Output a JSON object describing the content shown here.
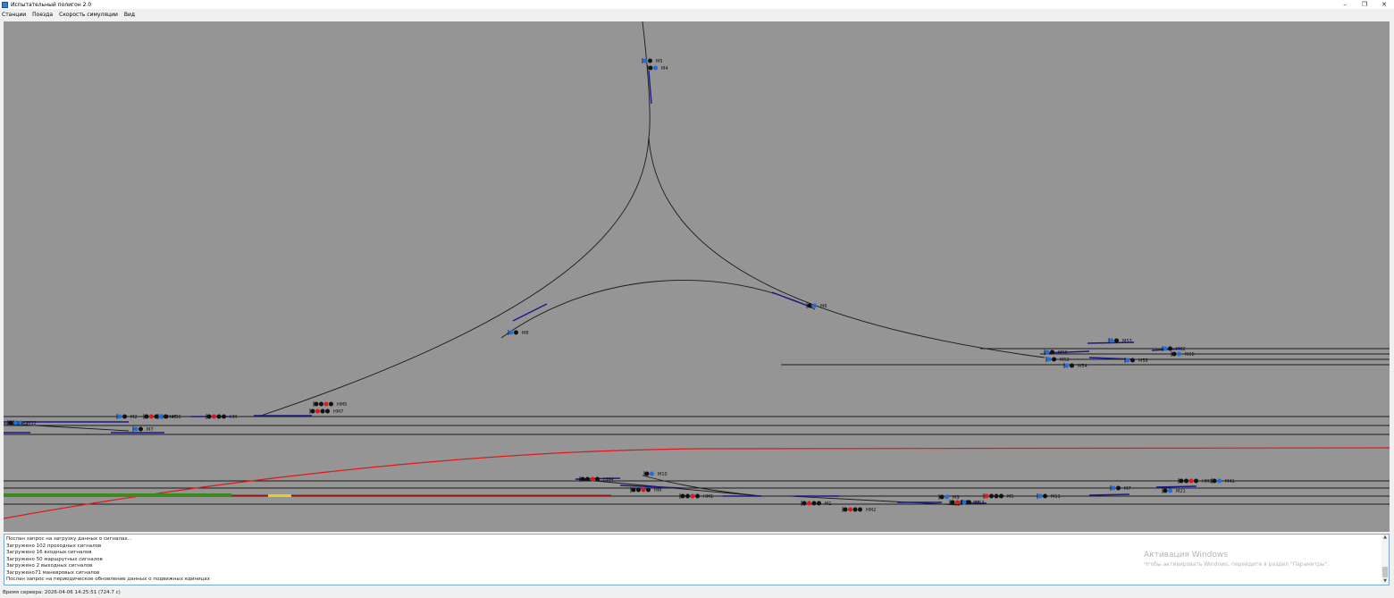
{
  "window": {
    "title": "Испытательный полигон 2.0",
    "minimize": "–",
    "restore": "❐",
    "close": "✕"
  },
  "menu": {
    "items": [
      "Станции",
      "Поезда",
      "Скорость симуляции",
      "Вид"
    ]
  },
  "colors": {
    "canvas_bg": "#959595",
    "track": "#1a1a1a",
    "route": "#1a1a8c",
    "occupied": "#e01818",
    "train": "#3c8a1e",
    "signal_blue": "#1e6ee0",
    "signal_red": "#e01818",
    "signal_black": "#111111",
    "highlight": "#e4d21a"
  },
  "canvas": {
    "signals": [
      {
        "label": "M8",
        "lights": [
          "blue",
          "black"
        ]
      },
      {
        "label": "M6",
        "lights": [
          "black",
          "blue"
        ]
      },
      {
        "label": "M5",
        "lights": [
          "blue",
          "black"
        ]
      },
      {
        "label": "M4",
        "lights": [
          "black",
          "blue"
        ]
      },
      {
        "label": "M2",
        "lights": [
          "blue",
          "black"
        ]
      },
      {
        "label": "M32",
        "lights": [
          "black",
          "blue"
        ]
      },
      {
        "label": "M56",
        "lights": [
          "blue",
          "black"
        ]
      },
      {
        "label": "M52",
        "lights": [
          "blue",
          "black"
        ]
      },
      {
        "label": "M54",
        "lights": [
          "blue",
          "black"
        ]
      },
      {
        "label": "M53",
        "lights": [
          "blue",
          "black"
        ]
      },
      {
        "label": "M58",
        "lights": [
          "blue",
          "black"
        ]
      },
      {
        "label": "M62",
        "lights": [
          "blue",
          "black"
        ]
      },
      {
        "label": "M60",
        "lights": [
          "black",
          "blue"
        ]
      },
      {
        "label": "M10",
        "lights": [
          "black",
          "blue"
        ]
      },
      {
        "label": "M7",
        "lights": [
          "blue",
          "black"
        ]
      },
      {
        "label": "НМ1",
        "lights": [
          "black",
          "black",
          "red",
          "black"
        ]
      },
      {
        "label": "НМ",
        "lights": [
          "black",
          "black",
          "red",
          "black"
        ]
      },
      {
        "label": "M1",
        "lights": [
          "black",
          "red",
          "black",
          "black"
        ]
      },
      {
        "label": "НМ2",
        "lights": [
          "black",
          "red",
          "black",
          "black"
        ]
      },
      {
        "label": "НМ4",
        "lights": [
          "black",
          "black",
          "red",
          "black"
        ]
      },
      {
        "label": "M3",
        "lights": [
          "black",
          "red",
          "black",
          "black"
        ]
      },
      {
        "label": "M5",
        "lights": [
          "red",
          "black",
          "black",
          "black"
        ]
      },
      {
        "label": "M13",
        "lights": [
          "blue",
          "black"
        ]
      },
      {
        "label": "M9",
        "lights": [
          "black",
          "blue"
        ]
      },
      {
        "label": "M11",
        "lights": [
          "blue",
          "black"
        ]
      },
      {
        "label": "M21",
        "lights": [
          "black",
          "blue"
        ]
      },
      {
        "label": "НМ3",
        "lights": [
          "black",
          "black",
          "red",
          "black"
        ]
      },
      {
        "label": "M7",
        "lights": [
          "blue",
          "black"
        ]
      },
      {
        "label": "НМ5",
        "lights": [
          "black",
          "black",
          "red",
          "black"
        ]
      },
      {
        "label": "НМ7",
        "lights": [
          "black",
          "red",
          "black",
          "black"
        ]
      },
      {
        "label": "M41",
        "lights": [
          "black",
          "blue"
        ]
      },
      {
        "label": "M47",
        "lights": [
          "black",
          "red",
          "black",
          "black"
        ]
      },
      {
        "label": "M2",
        "lights": [
          "black",
          "blue"
        ]
      },
      {
        "label": "M36",
        "lights": [
          "blue",
          "black"
        ]
      },
      {
        "label": "НМ",
        "lights": [
          "black",
          "red",
          "black",
          "black"
        ]
      }
    ]
  },
  "log": {
    "lines": [
      "Послан запрос на загрузку данных о сигналах...",
      "Загружено 102 проходных сигналов",
      "Загружено 16 входных сигналов",
      "Загружено 50 маршрутных сигналов",
      "Загружено 2 выходных сигналов",
      "Загружено71 маневровых сигналов",
      "Послан запрос на периодическое обновление данных о подвижных единицах"
    ]
  },
  "activation": {
    "title": "Активация Windows",
    "subtitle": "Чтобы активировать Windows, перейдите в раздел \"Параметры\"."
  },
  "status": {
    "server_time": "Время сервера: 2026-04-06 14:25:51 (724.7 с)"
  }
}
